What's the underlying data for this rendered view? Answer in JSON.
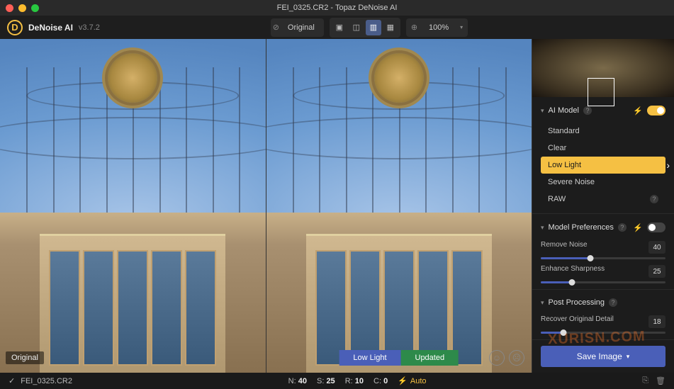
{
  "window": {
    "title": "FEI_0325.CR2 - Topaz DeNoise AI"
  },
  "header": {
    "logo_letter": "D",
    "app_name": "DeNoise AI",
    "version": "v3.7.2",
    "original_btn": "Original",
    "zoom": "100%"
  },
  "viewer": {
    "left_label": "Original",
    "badge_model": "Low Light",
    "badge_status": "Updated"
  },
  "ai_model": {
    "title": "AI Model",
    "items": [
      "Standard",
      "Clear",
      "Low Light",
      "Severe Noise",
      "RAW"
    ],
    "selected_index": 2
  },
  "prefs": {
    "title": "Model Preferences",
    "remove_noise": {
      "label": "Remove Noise",
      "value": 40
    },
    "enhance_sharpness": {
      "label": "Enhance Sharpness",
      "value": 25
    }
  },
  "post": {
    "title": "Post Processing",
    "recover_detail": {
      "label": "Recover Original Detail",
      "value": 18
    }
  },
  "save_btn": "Save Image",
  "footer": {
    "filename": "FEI_0325.CR2",
    "stats": {
      "N": 40,
      "S": 25,
      "R": 10,
      "C": 0
    },
    "auto": "Auto"
  },
  "watermark": "XURISN.COM"
}
